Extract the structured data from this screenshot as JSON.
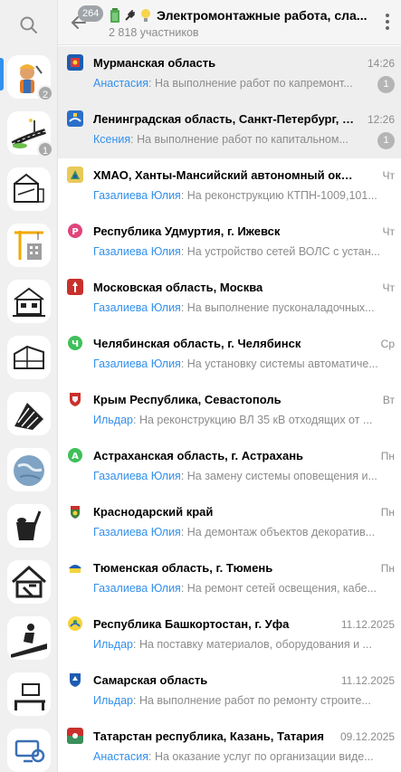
{
  "header": {
    "unread_count": "264",
    "title": "Электромонтажные работа, сла...",
    "subtitle": "2 818 участников"
  },
  "rail": {
    "badges": [
      "2",
      "1"
    ]
  },
  "chats": [
    {
      "name": "Мурманская область",
      "time": "14:26",
      "sender": "Анастасия",
      "preview": "На выполнение работ по капремонт...",
      "unread": "1"
    },
    {
      "name": "Ленинградская область, Санкт-Петербург, С...",
      "time": "12:26",
      "sender": "Ксения",
      "preview": "На выполнение работ по капитальном...",
      "unread": "1"
    },
    {
      "name": "ХМАО, Ханты-Мансийский автономный округ",
      "time": "Чт",
      "sender": "Газалиева Юлия",
      "preview": "На реконструкцию КТПН-1009,101...",
      "unread": ""
    },
    {
      "name": "Республика Удмуртия, г. Ижевск",
      "time": "Чт",
      "sender": "Газалиева Юлия",
      "preview": "На устройство сетей ВОЛС с устан...",
      "unread": ""
    },
    {
      "name": "Московская область, Москва",
      "time": "Чт",
      "sender": "Газалиева Юлия",
      "preview": "На выполнение пусконаладочных...",
      "unread": ""
    },
    {
      "name": "Челябинская область, г. Челябинск",
      "time": "Ср",
      "sender": "Газалиева Юлия",
      "preview": "На установку системы автоматиче...",
      "unread": ""
    },
    {
      "name": "Крым Республика, Севастополь",
      "time": "Вт",
      "sender": "Ильдар",
      "preview": "На реконструкцию ВЛ 35 кВ отходящих от ...",
      "unread": ""
    },
    {
      "name": "Астраханская область, г. Астрахань",
      "time": "Пн",
      "sender": "Газалиева Юлия",
      "preview": "На замену системы оповещения и...",
      "unread": ""
    },
    {
      "name": "Краснодарский край",
      "time": "Пн",
      "sender": "Газалиева Юлия",
      "preview": "На демонтаж объектов декоратив...",
      "unread": ""
    },
    {
      "name": "Тюменская область, г. Тюмень",
      "time": "Пн",
      "sender": "Газалиева Юлия",
      "preview": "На ремонт сетей освещения, кабе...",
      "unread": ""
    },
    {
      "name": "Республика Башкортостан, г. Уфа",
      "time": "11.12.2025",
      "sender": "Ильдар",
      "preview": "На поставку материалов, оборудования и ...",
      "unread": ""
    },
    {
      "name": "Самарская область",
      "time": "11.12.2025",
      "sender": "Ильдар",
      "preview": "На выполнение работ по ремонту строите...",
      "unread": ""
    },
    {
      "name": "Татарстан республика, Казань, Татария",
      "time": "09.12.2025",
      "sender": "Анастасия",
      "preview": "На оказание услуг по организации виде...",
      "unread": ""
    }
  ],
  "colors": {
    "accent": "#3390ec",
    "sender": "#3390ec",
    "muted": "#8c8c8c",
    "badge": "#b5b5b5",
    "selected_row": "#eeeeee"
  }
}
